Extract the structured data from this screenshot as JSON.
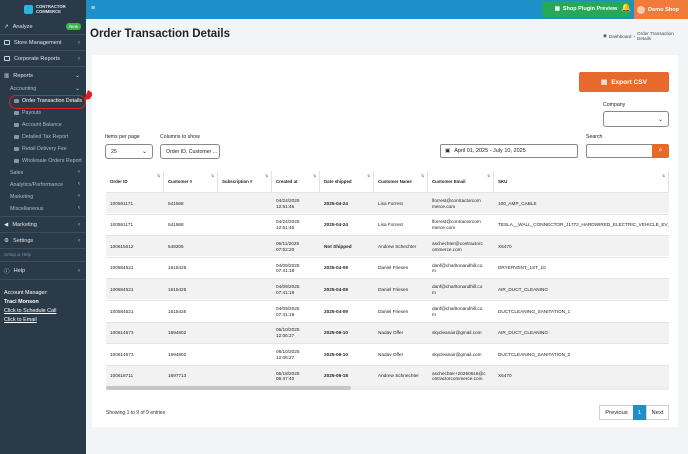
{
  "brand": {
    "name_line1": "CONTRACTOR",
    "name_line2": "COMMERCE"
  },
  "sidebar": {
    "analyze": "Analyze",
    "analyze_badge": "New",
    "store_management": "Store Management",
    "corporate_reports": "Corporate Reports",
    "reports": "Reports",
    "accounting": "Accounting",
    "accounting_items": [
      "Order Transaction Details",
      "Payouts",
      "Account Balance",
      "Detailed Tax Report",
      "Retail Delivery Fee",
      "Wholesale Orders Report"
    ],
    "sales": "Sales",
    "analytics_performance": "Analytics/Performance",
    "marketing_sub": "Marketing",
    "miscellaneous": "Miscellaneous",
    "marketing": "Marketing",
    "settings": "Settings",
    "setup_help": "Setup & Help",
    "help": "Help",
    "account_manager_label": "Account Manager:",
    "account_manager_name": "Traci Monson",
    "schedule_call": "Click to Schedule Call",
    "email": "Click to Email"
  },
  "topbar": {
    "plugin_preview": "Shop Plugin Preview",
    "demo_shop": "Demo Shop"
  },
  "page": {
    "title": "Order Transaction Details",
    "breadcrumb_home": "Dashboard",
    "breadcrumb_current": "Order Transaction Details"
  },
  "filters": {
    "export_csv": "Export CSV",
    "company_label": "Company",
    "items_per_page_label": "Items per page",
    "items_per_page_value": "25",
    "columns_label": "Columns to show",
    "columns_value": "Order ID, Customer ...",
    "date_range": "April 01, 2025 - July 10, 2025",
    "search_label": "Search"
  },
  "table": {
    "headers": [
      "Order ID",
      "Customer #",
      "Subscription #",
      "Created at",
      "Date shipped",
      "Customer Name",
      "Customer Email",
      "SKU"
    ],
    "rows": [
      [
        "100591171",
        "541568",
        "",
        "04/24/2025\n12:51:46",
        "2025-04-24",
        "Lisa Forrest",
        "lforrest@contractorcom\nmerce.com",
        "100_AMP_CABLE"
      ],
      [
        "100591171",
        "541568",
        "",
        "04/24/2025\n12:51:46",
        "2025-04-24",
        "Lisa Forrest",
        "lforrest@contractorcom\nmerce.com",
        "TESLA__WALL_CONNECTOR_J1772_HARDWIRED_ELECTRIC_VEHICLE_EV_CHARGER"
      ],
      [
        "100615012",
        "548205",
        "",
        "06/11/2025\n07:52:20",
        "Not Shipped",
        "Andrew Schechter",
        "aschechter@contractorc\nommerce.com",
        "X6470"
      ],
      [
        "100584521",
        "1615425",
        "",
        "04/09/2025\n07:41:18",
        "2025-04-09",
        "Daniel Friesen",
        "danf@charltonandhill.co\nm",
        "DRYERVENT_1ST_10"
      ],
      [
        "100584521",
        "1615425",
        "",
        "04/09/2025\n07:41:18",
        "2025-04-09",
        "Daniel Friesen",
        "danf@charltonandhill.co\nm",
        "AIR_DUCT_CLEANING"
      ],
      [
        "100584521",
        "1615425",
        "",
        "04/09/2025\n07:41:18",
        "2025-04-09",
        "Daniel Friesen",
        "danf@charltonandhill.co\nm",
        "DUCTCLEANING_SANITATION_1"
      ],
      [
        "100614573",
        "1694802",
        "",
        "06/10/2025\n12:06:27",
        "2025-06-10",
        "Nadav Offer",
        "skycleanair@gmail.com",
        "AIR_DUCT_CLEANING"
      ],
      [
        "100614573",
        "1694802",
        "",
        "06/10/2025\n12:06:27",
        "2025-06-10",
        "Nadav Offer",
        "skycleanair@gmail.com",
        "DUCTCLEANING_SANITATION_2"
      ],
      [
        "100618711",
        "1697713",
        "",
        "06/18/2025\n06:47:40",
        "2025-06-18",
        "Andrew Schnechter",
        "aschechter+20250618@c\nontractorcommerce.com",
        "X6470"
      ]
    ]
  },
  "footer": {
    "showing": "Showing 1 to 9 of 9 entries",
    "previous": "Previous",
    "page": "1",
    "next": "Next"
  },
  "colors": {
    "accent": "#1e8fc9",
    "export": "#e8692c",
    "green": "#26a85a",
    "sidebar": "#2b3a48"
  }
}
